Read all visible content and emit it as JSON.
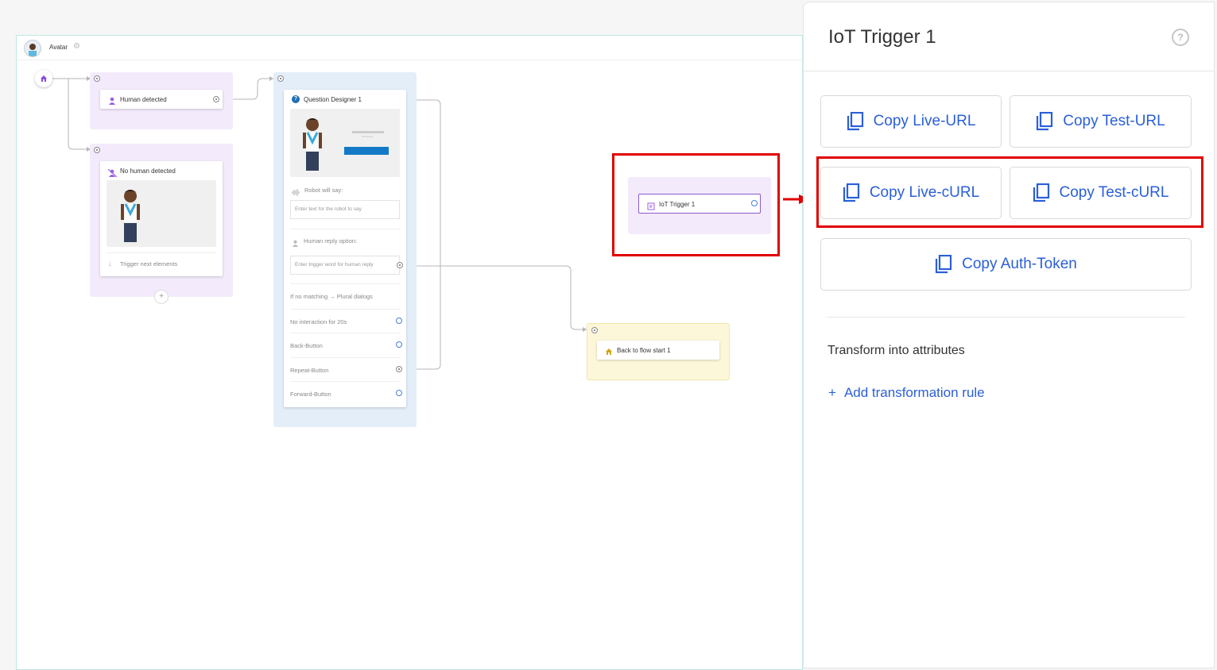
{
  "canvas": {
    "header": {
      "label": "Avatar"
    },
    "nodes": {
      "human_detected": {
        "label": "Human detected"
      },
      "no_human_detected": {
        "label": "No human detected",
        "trigger_next": "Trigger next elements"
      },
      "question_designer": {
        "title": "Question Designer 1",
        "robot_say_label": "Robot will say:",
        "robot_say_placeholder": "Enter text for the robot to say",
        "human_reply_label": "Human reply option:",
        "human_reply_placeholder": "Enter trigger word for human reply",
        "no_match": "If no matching → Plural dialogs",
        "rows": [
          "No interaction for 20s",
          "Back-Button",
          "Repeat-Button",
          "Forward-Button"
        ]
      },
      "iot_trigger": {
        "label": "IoT Trigger 1"
      },
      "back_to_flow": {
        "label": "Back to flow start 1"
      }
    }
  },
  "panel": {
    "title": "IoT Trigger 1",
    "buttons": {
      "copy_live_url": "Copy Live-URL",
      "copy_test_url": "Copy Test-URL",
      "copy_live_curl": "Copy Live-cURL",
      "copy_test_curl": "Copy Test-cURL",
      "copy_auth_token": "Copy Auth-Token"
    },
    "transform_title": "Transform into attributes",
    "add_rule": "Add transformation rule"
  },
  "colors": {
    "accent": "#2a5fd9",
    "highlight": "#e10000",
    "node_purple": "#f3eafb",
    "node_blue": "#e3eef9",
    "node_yellow": "#fdf7d9"
  },
  "icons": [
    "home-icon",
    "person-icon",
    "no-person-icon",
    "question-icon",
    "sound-wave-icon",
    "arrow-down-icon",
    "iot-icon",
    "house-icon",
    "copy-icon",
    "help-icon",
    "gear-icon",
    "plus-icon"
  ]
}
